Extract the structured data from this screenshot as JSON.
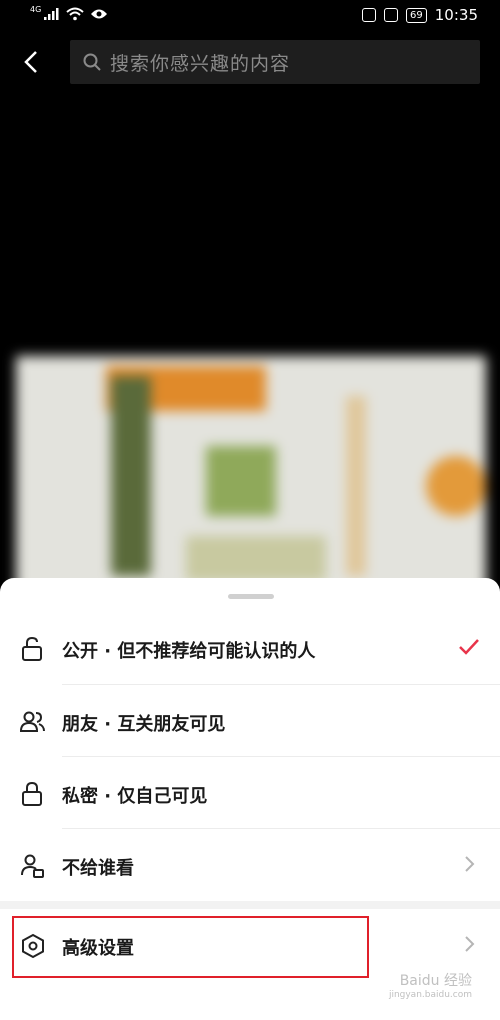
{
  "status_bar": {
    "network": "4G",
    "battery": "69",
    "time": "10:35"
  },
  "search": {
    "placeholder": "搜索你感兴趣的内容"
  },
  "sheet": {
    "options": [
      {
        "label": "公开 · 但不推荐给可能认识的人",
        "icon": "unlock-icon",
        "selected": true
      },
      {
        "label": "朋友 · 互关朋友可见",
        "icon": "friends-icon"
      },
      {
        "label": "私密 · 仅自己可见",
        "icon": "lock-icon"
      },
      {
        "label": "不给谁看",
        "icon": "user-block-icon"
      }
    ],
    "advanced": {
      "label": "高级设置",
      "icon": "hexagon-settings-icon"
    }
  },
  "colors": {
    "check": "#e8344a",
    "highlight": "#e0202a"
  },
  "watermark": {
    "main": "Baidu 经验",
    "sub": "jingyan.baidu.com"
  }
}
